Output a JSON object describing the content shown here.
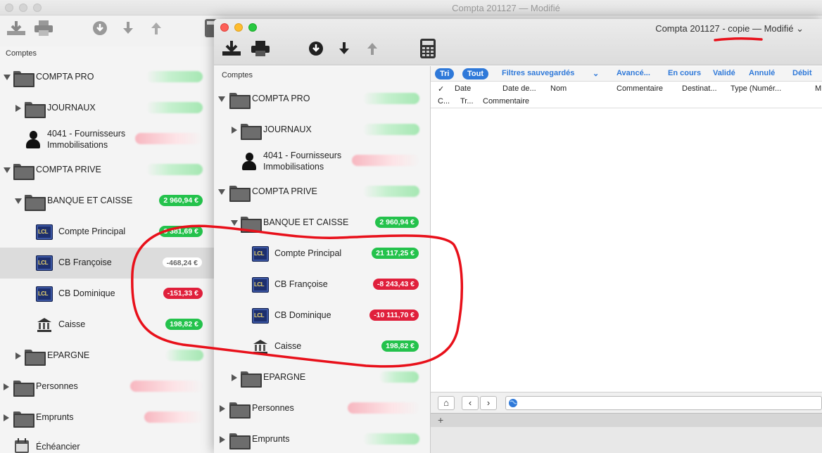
{
  "back_window": {
    "title": "Compta 201127 — Modifié",
    "section": "Comptes",
    "rows": [
      {
        "label": "COMPTA PRO"
      },
      {
        "label": "JOURNAUX"
      },
      {
        "label_line1": "4041 - Fournisseurs",
        "label_line2": "Immobilisations"
      },
      {
        "label": "COMPTA PRIVE"
      },
      {
        "label": "BANQUE ET CAISSE",
        "balance": "2 960,94 €"
      },
      {
        "label": "Compte Principal",
        "balance": "3 381,69 €"
      },
      {
        "label": "CB Françoise",
        "balance": "-468,24 €"
      },
      {
        "label": "CB Dominique",
        "balance": "-151,33 €"
      },
      {
        "label": "Caisse",
        "balance": "198,82 €"
      },
      {
        "label": "EPARGNE"
      },
      {
        "label": "Personnes"
      },
      {
        "label": "Emprunts"
      },
      {
        "label": "Échéancier"
      }
    ]
  },
  "front_window": {
    "title": "Compta 201127 - copie — Modifié ⌄",
    "section": "Comptes",
    "rows": [
      {
        "label": "COMPTA PRO"
      },
      {
        "label": "JOURNAUX"
      },
      {
        "label_line1": "4041 - Fournisseurs",
        "label_line2": "Immobilisations"
      },
      {
        "label": "COMPTA PRIVE"
      },
      {
        "label": "BANQUE ET CAISSE",
        "balance": "2 960,94 €"
      },
      {
        "label": "Compte Principal",
        "balance": "21 117,25 €"
      },
      {
        "label": "CB Françoise",
        "balance": "-8 243,43 €"
      },
      {
        "label": "CB Dominique",
        "balance": "-10 111,70 €"
      },
      {
        "label": "Caisse",
        "balance": "198,82 €"
      },
      {
        "label": "EPARGNE"
      },
      {
        "label": "Personnes"
      },
      {
        "label": "Emprunts"
      }
    ],
    "filters": {
      "tri": "Tri",
      "tout": "Tout",
      "saved": "Filtres sauvegardés",
      "advanced": "Avancé...",
      "en_cours": "En cours",
      "valide": "Validé",
      "annule": "Annulé",
      "debit": "Débit"
    },
    "columns_row1": [
      "✓",
      "Date",
      "Date de...",
      "Nom",
      "Commentaire",
      "Destinat...",
      "Type (Numér...",
      "M"
    ],
    "columns_row2": [
      "C...",
      "Tr...",
      "Commentaire"
    ]
  },
  "colors": {
    "positive": "#24c24c",
    "negative": "#e0203c",
    "accent": "#2f79d9",
    "annotation": "#e8101a"
  }
}
